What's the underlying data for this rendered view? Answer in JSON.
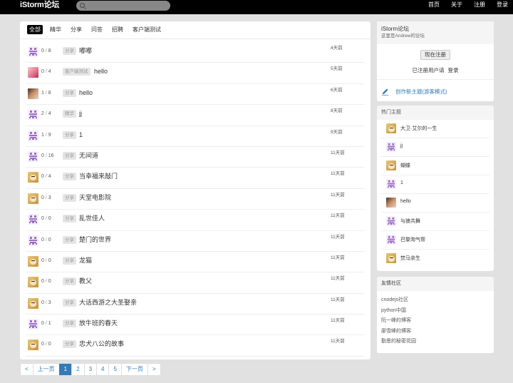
{
  "nav": {
    "brand": "iStorm论坛",
    "search_placeholder": "",
    "links": [
      "首页",
      "关于",
      "注册",
      "登录"
    ]
  },
  "tabs": [
    "全部",
    "精华",
    "分享",
    "问答",
    "招聘",
    "客户端测试"
  ],
  "active_tab": "全部",
  "topics": [
    {
      "avatar": "default",
      "replies": "0",
      "views": "8",
      "tag": "分享",
      "title": "嘟嘟",
      "time": "4天前"
    },
    {
      "avatar": "anime",
      "replies": "0",
      "views": "4",
      "tag": "客户端测试",
      "title": "hello",
      "time": "5天前"
    },
    {
      "avatar": "cat",
      "replies": "1",
      "views": "8",
      "tag": "分享",
      "title": "hello",
      "time": "6天前"
    },
    {
      "avatar": "default",
      "replies": "2",
      "views": "4",
      "tag": "精华",
      "title": "jj",
      "time": "8天前"
    },
    {
      "avatar": "default",
      "replies": "1",
      "views": "9",
      "tag": "分享",
      "title": "1",
      "time": "9天前"
    },
    {
      "avatar": "default",
      "replies": "0",
      "views": "16",
      "tag": "分享",
      "title": "无间道",
      "time": "11天前"
    },
    {
      "avatar": "doge",
      "replies": "0",
      "views": "4",
      "tag": "分享",
      "title": "当幸福来敲门",
      "time": "11天前"
    },
    {
      "avatar": "doge",
      "replies": "0",
      "views": "3",
      "tag": "分享",
      "title": "天堂电影院",
      "time": "11天前"
    },
    {
      "avatar": "default",
      "replies": "0",
      "views": "0",
      "tag": "分享",
      "title": "乱世佳人",
      "time": "11天前"
    },
    {
      "avatar": "default",
      "replies": "0",
      "views": "0",
      "tag": "分享",
      "title": "楚门的世界",
      "time": "11天前"
    },
    {
      "avatar": "doge",
      "replies": "0",
      "views": "0",
      "tag": "分享",
      "title": "龙猫",
      "time": "11天前"
    },
    {
      "avatar": "doge",
      "replies": "0",
      "views": "0",
      "tag": "分享",
      "title": "教父",
      "time": "11天前"
    },
    {
      "avatar": "doge",
      "replies": "0",
      "views": "3",
      "tag": "分享",
      "title": "大话西游之大圣娶亲",
      "time": "11天前"
    },
    {
      "avatar": "default",
      "replies": "0",
      "views": "1",
      "tag": "分享",
      "title": "放牛班的春天",
      "time": "11天前"
    },
    {
      "avatar": "doge",
      "replies": "0",
      "views": "0",
      "tag": "分享",
      "title": "忠犬八公的故事",
      "time": "11天前"
    }
  ],
  "pagination": [
    "<",
    "上一页",
    "1",
    "2",
    "3",
    "4",
    "5",
    "下一页",
    ">"
  ],
  "active_page": "1",
  "intro": {
    "site_name": "iStorm论坛",
    "description": "这里是Andrew的论坛",
    "register_button": "现在注册",
    "login_prompt": "已注册用户请",
    "login_link": "登录",
    "create_topic": "创作新主题(游客模式)"
  },
  "hot": {
    "title": "热门主题",
    "items": [
      {
        "avatar": "doge",
        "title": "大卫·艾尔的一生"
      },
      {
        "avatar": "default",
        "title": "jj"
      },
      {
        "avatar": "doge",
        "title": "蝴蝶"
      },
      {
        "avatar": "default",
        "title": "1"
      },
      {
        "avatar": "cat",
        "title": "hello"
      },
      {
        "avatar": "default",
        "title": "与狼共舞"
      },
      {
        "avatar": "default",
        "title": "巴黎淘气帮"
      },
      {
        "avatar": "doge",
        "title": "焚马余生"
      }
    ]
  },
  "friends": {
    "title": "友情社区",
    "links": [
      "cnodejs社区",
      "python中国",
      "阮一峰的博客",
      "廖雪峰的博客",
      "勤思的秘密花园"
    ]
  },
  "colors": {
    "navbar": "#000000",
    "page_bg": "#e1e1e1",
    "link_blue": "#337ab7",
    "tag_bg": "#e5e5e5"
  }
}
